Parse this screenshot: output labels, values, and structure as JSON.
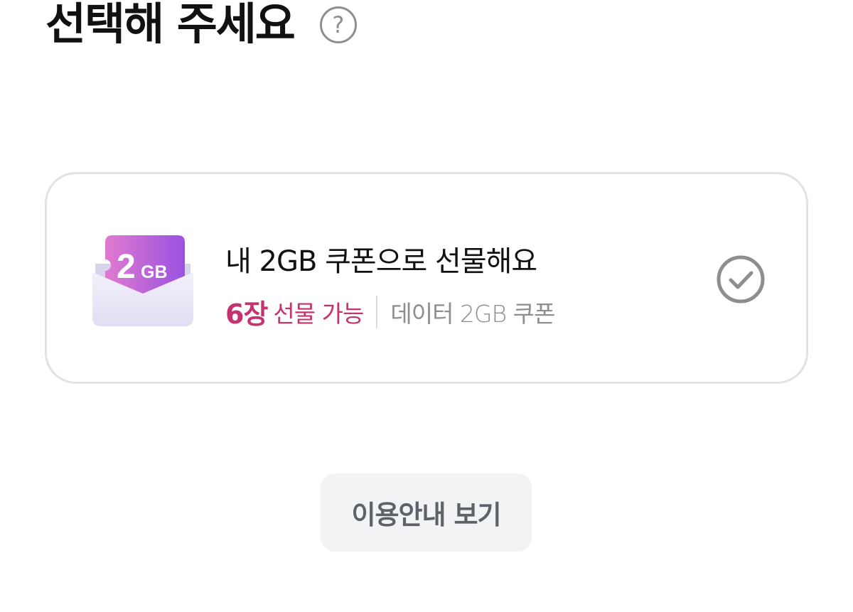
{
  "header": {
    "title": "선택해 주세요",
    "help_icon_label": "?"
  },
  "coupon_option": {
    "badge_text": "2",
    "badge_unit": "GB",
    "title": "내 2GB 쿠폰으로 선물해요",
    "available_count": "6장",
    "available_text": "선물 가능",
    "coupon_type": "데이터 2GB 쿠폰",
    "icon": "check-circle-icon",
    "selected": false
  },
  "guide_button": {
    "label": "이용안내 보기"
  },
  "colors": {
    "accent": "#c4336e",
    "coupon_purple": "#b45cd8",
    "coupon_pink": "#e07ad0",
    "check_gray": "#8e8e8e",
    "button_bg": "#f2f3f5"
  }
}
